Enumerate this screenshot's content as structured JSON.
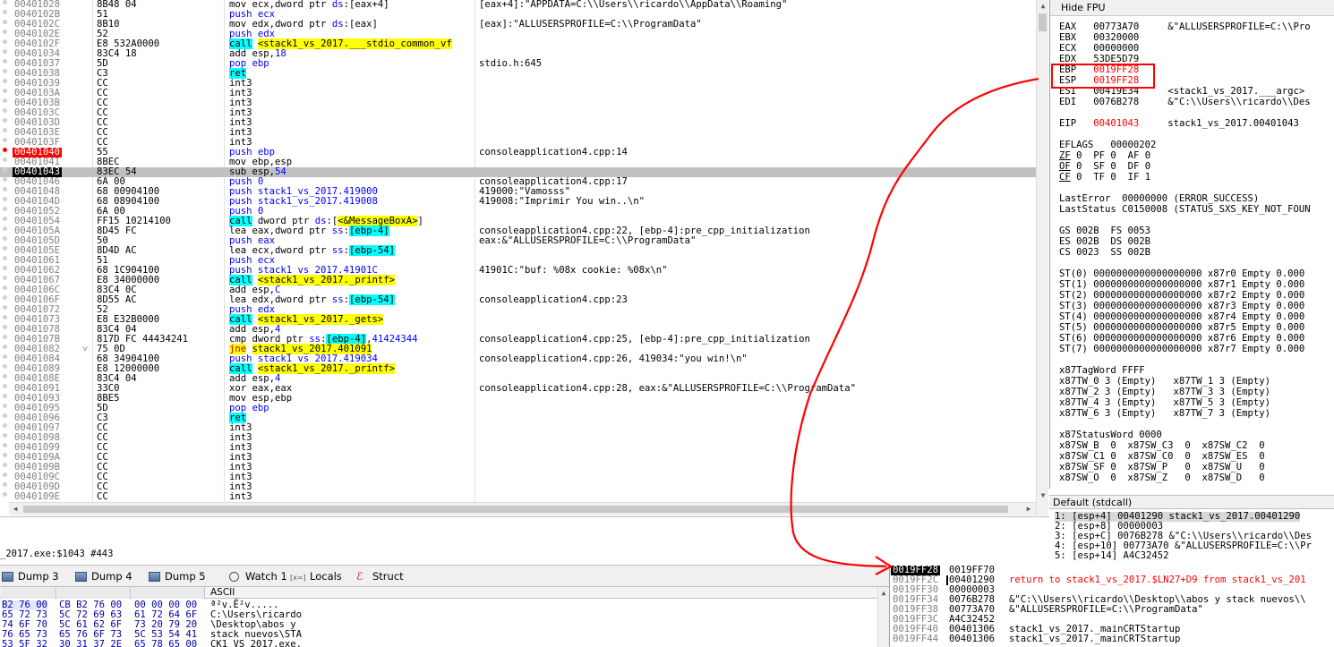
{
  "disassembly": [
    {
      "addr": "00401028",
      "bytes": "8B48 04",
      "instr": [
        [
          "",
          "mov ecx,dword ptr "
        ],
        [
          "mnem-push",
          "ds"
        ],
        [
          "",
          ":[eax+4]"
        ]
      ],
      "cmt": "[eax+4]:\"APPDATA=C:\\\\Users\\\\ricardo\\\\AppData\\\\Roaming\""
    },
    {
      "addr": "0040102B",
      "bytes": "51",
      "instr": [
        [
          "mnem-push",
          "push ecx"
        ]
      ],
      "cmt": ""
    },
    {
      "addr": "0040102C",
      "bytes": "8B10",
      "instr": [
        [
          "",
          "mov edx,dword ptr "
        ],
        [
          "mnem-push",
          "ds"
        ],
        [
          "",
          ":[eax]"
        ]
      ],
      "cmt": "[eax]:\"ALLUSERSPROFILE=C:\\\\ProgramData\""
    },
    {
      "addr": "0040102E",
      "bytes": "52",
      "instr": [
        [
          "mnem-push",
          "push edx"
        ]
      ],
      "cmt": ""
    },
    {
      "addr": "0040102F",
      "bytes": "E8 532A0000",
      "instr": [
        [
          "hl-call",
          "call"
        ],
        [
          "",
          " "
        ],
        [
          "hl-tgt",
          "<stack1_vs_2017.___stdio_common_vf"
        ]
      ],
      "cmt": ""
    },
    {
      "addr": "00401034",
      "bytes": "83C4 18",
      "instr": [
        [
          "",
          "add esp,"
        ],
        [
          "mnem-push",
          "18"
        ]
      ],
      "cmt": ""
    },
    {
      "addr": "00401037",
      "bytes": "5D",
      "instr": [
        [
          "mnem-push",
          "pop ebp"
        ]
      ],
      "cmt": "stdio.h:645"
    },
    {
      "addr": "00401038",
      "bytes": "C3",
      "instr": [
        [
          "hl-ret",
          "ret"
        ]
      ],
      "cmt": ""
    },
    {
      "addr": "00401039",
      "bytes": "CC",
      "instr": [
        [
          "",
          "int3"
        ]
      ],
      "cmt": ""
    },
    {
      "addr": "0040103A",
      "bytes": "CC",
      "instr": [
        [
          "",
          "int3"
        ]
      ],
      "cmt": ""
    },
    {
      "addr": "0040103B",
      "bytes": "CC",
      "instr": [
        [
          "",
          "int3"
        ]
      ],
      "cmt": ""
    },
    {
      "addr": "0040103C",
      "bytes": "CC",
      "instr": [
        [
          "",
          "int3"
        ]
      ],
      "cmt": ""
    },
    {
      "addr": "0040103D",
      "bytes": "CC",
      "instr": [
        [
          "",
          "int3"
        ]
      ],
      "cmt": ""
    },
    {
      "addr": "0040103E",
      "bytes": "CC",
      "instr": [
        [
          "",
          "int3"
        ]
      ],
      "cmt": ""
    },
    {
      "addr": "0040103F",
      "bytes": "CC",
      "instr": [
        [
          "",
          "int3"
        ]
      ],
      "cmt": ""
    },
    {
      "addr": "00401040",
      "bytes": "55",
      "instr": [
        [
          "mnem-push",
          "push ebp"
        ]
      ],
      "cmt": "consoleapplication4.cpp:14",
      "state": "bp"
    },
    {
      "addr": "00401041",
      "bytes": "8BEC",
      "instr": [
        [
          "",
          "mov ebp,esp"
        ]
      ],
      "cmt": ""
    },
    {
      "addr": "00401043",
      "bytes": "83EC 54",
      "instr": [
        [
          "",
          "sub esp,"
        ],
        [
          "mnem-push",
          "54"
        ]
      ],
      "cmt": "",
      "state": "cur"
    },
    {
      "addr": "00401046",
      "bytes": "6A 00",
      "instr": [
        [
          "mnem-push",
          "push 0"
        ]
      ],
      "cmt": "consoleapplication4.cpp:17"
    },
    {
      "addr": "00401048",
      "bytes": "68 00904100",
      "instr": [
        [
          "mnem-push",
          "push stack1_vs_2017.419000"
        ]
      ],
      "cmt": "419000:\"Vamosss\""
    },
    {
      "addr": "0040104D",
      "bytes": "68 08904100",
      "instr": [
        [
          "mnem-push",
          "push stack1_vs_2017.419008"
        ]
      ],
      "cmt": "419008:\"Imprimir You win..\\n\""
    },
    {
      "addr": "00401052",
      "bytes": "6A 00",
      "instr": [
        [
          "mnem-push",
          "push 0"
        ]
      ],
      "cmt": ""
    },
    {
      "addr": "00401054",
      "bytes": "FF15 10214100",
      "instr": [
        [
          "hl-call",
          "call"
        ],
        [
          "",
          " dword ptr "
        ],
        [
          "mnem-push",
          "ds"
        ],
        [
          "",
          ":["
        ],
        [
          "hl-tgt",
          "<&MessageBoxA>"
        ],
        [
          "",
          "]"
        ]
      ],
      "cmt": ""
    },
    {
      "addr": "0040105A",
      "bytes": "8D45 FC",
      "instr": [
        [
          "",
          "lea eax,dword ptr "
        ],
        [
          "mnem-push",
          "ss"
        ],
        [
          "",
          ":"
        ],
        [
          "hl-call",
          "[ebp-4]"
        ]
      ],
      "cmt": "consoleapplication4.cpp:22, [ebp-4]:pre_cpp_initialization"
    },
    {
      "addr": "0040105D",
      "bytes": "50",
      "instr": [
        [
          "mnem-push",
          "push eax"
        ]
      ],
      "cmt": "eax:&\"ALLUSERSPROFILE=C:\\\\ProgramData\""
    },
    {
      "addr": "0040105E",
      "bytes": "8D4D AC",
      "instr": [
        [
          "",
          "lea ecx,dword ptr "
        ],
        [
          "mnem-push",
          "ss"
        ],
        [
          "",
          ":"
        ],
        [
          "hl-call",
          "[ebp-54]"
        ]
      ],
      "cmt": ""
    },
    {
      "addr": "00401061",
      "bytes": "51",
      "instr": [
        [
          "mnem-push",
          "push ecx"
        ]
      ],
      "cmt": ""
    },
    {
      "addr": "00401062",
      "bytes": "68 1C904100",
      "instr": [
        [
          "mnem-push",
          "push stack1_vs_2017.41901C"
        ]
      ],
      "cmt": "41901C:\"buf: %08x cookie: %08x\\n\""
    },
    {
      "addr": "00401067",
      "bytes": "E8 34000000",
      "instr": [
        [
          "hl-call",
          "call"
        ],
        [
          "",
          " "
        ],
        [
          "hl-tgt",
          "<stack1_vs_2017._printf>"
        ]
      ],
      "cmt": ""
    },
    {
      "addr": "0040106C",
      "bytes": "83C4 0C",
      "instr": [
        [
          "",
          "add esp,"
        ],
        [
          "mnem-push",
          "C"
        ]
      ],
      "cmt": ""
    },
    {
      "addr": "0040106F",
      "bytes": "8D55 AC",
      "instr": [
        [
          "",
          "lea edx,dword ptr "
        ],
        [
          "mnem-push",
          "ss"
        ],
        [
          "",
          ":"
        ],
        [
          "hl-call",
          "[ebp-54]"
        ]
      ],
      "cmt": "consoleapplication4.cpp:23"
    },
    {
      "addr": "00401072",
      "bytes": "52",
      "instr": [
        [
          "mnem-push",
          "push edx"
        ]
      ],
      "cmt": ""
    },
    {
      "addr": "00401073",
      "bytes": "E8 E32B0000",
      "instr": [
        [
          "hl-call",
          "call"
        ],
        [
          "",
          " "
        ],
        [
          "hl-tgt",
          "<stack1_vs_2017._gets>"
        ]
      ],
      "cmt": ""
    },
    {
      "addr": "00401078",
      "bytes": "83C4 04",
      "instr": [
        [
          "",
          "add esp,"
        ],
        [
          "mnem-push",
          "4"
        ]
      ],
      "cmt": ""
    },
    {
      "addr": "0040107B",
      "bytes": "817D FC 44434241",
      "instr": [
        [
          "",
          "cmp dword ptr "
        ],
        [
          "mnem-push",
          "ss"
        ],
        [
          "",
          ":"
        ],
        [
          "hl-call",
          "[ebp-4]"
        ],
        [
          "",
          ","
        ],
        [
          "mnem-push",
          "41424344"
        ]
      ],
      "cmt": "consoleapplication4.cpp:25, [ebp-4]:pre_cpp_initialization"
    },
    {
      "addr": "00401082",
      "bytes": "75 0D",
      "instr": [
        [
          "hl-jne",
          "jne"
        ],
        [
          "",
          " "
        ],
        [
          "hl-tgt",
          "stack1_vs_2017.401091"
        ]
      ],
      "cmt": "",
      "jmp": "˅"
    },
    {
      "addr": "00401084",
      "bytes": "68 34904100",
      "instr": [
        [
          "mnem-push",
          "push stack1_vs_2017.419034"
        ]
      ],
      "cmt": "consoleapplication4.cpp:26, 419034:\"you win!\\n\""
    },
    {
      "addr": "00401089",
      "bytes": "E8 12000000",
      "instr": [
        [
          "hl-call",
          "call"
        ],
        [
          "",
          " "
        ],
        [
          "hl-tgt",
          "<stack1_vs_2017._printf>"
        ]
      ],
      "cmt": ""
    },
    {
      "addr": "0040108E",
      "bytes": "83C4 04",
      "instr": [
        [
          "",
          "add esp,"
        ],
        [
          "mnem-push",
          "4"
        ]
      ],
      "cmt": ""
    },
    {
      "addr": "00401091",
      "bytes": "33C0",
      "instr": [
        [
          "",
          "xor eax,eax"
        ]
      ],
      "cmt": "consoleapplication4.cpp:28, eax:&\"ALLUSERSPROFILE=C:\\\\ProgramData\""
    },
    {
      "addr": "00401093",
      "bytes": "8BE5",
      "instr": [
        [
          "",
          "mov esp,ebp"
        ]
      ],
      "cmt": ""
    },
    {
      "addr": "00401095",
      "bytes": "5D",
      "instr": [
        [
          "mnem-push",
          "pop ebp"
        ]
      ],
      "cmt": ""
    },
    {
      "addr": "00401096",
      "bytes": "C3",
      "instr": [
        [
          "hl-ret",
          "ret"
        ]
      ],
      "cmt": ""
    },
    {
      "addr": "00401097",
      "bytes": "CC",
      "instr": [
        [
          "",
          "int3"
        ]
      ],
      "cmt": ""
    },
    {
      "addr": "00401098",
      "bytes": "CC",
      "instr": [
        [
          "",
          "int3"
        ]
      ],
      "cmt": ""
    },
    {
      "addr": "00401099",
      "bytes": "CC",
      "instr": [
        [
          "",
          "int3"
        ]
      ],
      "cmt": ""
    },
    {
      "addr": "0040109A",
      "bytes": "CC",
      "instr": [
        [
          "",
          "int3"
        ]
      ],
      "cmt": ""
    },
    {
      "addr": "0040109B",
      "bytes": "CC",
      "instr": [
        [
          "",
          "int3"
        ]
      ],
      "cmt": ""
    },
    {
      "addr": "0040109C",
      "bytes": "CC",
      "instr": [
        [
          "",
          "int3"
        ]
      ],
      "cmt": ""
    },
    {
      "addr": "0040109D",
      "bytes": "CC",
      "instr": [
        [
          "",
          "int3"
        ]
      ],
      "cmt": ""
    },
    {
      "addr": "0040109E",
      "bytes": "CC",
      "instr": [
        [
          "",
          "int3"
        ]
      ],
      "cmt": ""
    }
  ],
  "info_text": "_2017.exe:$1043 #443",
  "registers": {
    "hide_fpu_label": "Hide FPU",
    "gp": [
      {
        "name": "EAX",
        "val": "00773A70",
        "cmt": "&\"ALLUSERSPROFILE=C:\\\\Pro"
      },
      {
        "name": "EBX",
        "val": "00320000",
        "cmt": ""
      },
      {
        "name": "ECX",
        "val": "00000000",
        "cmt": ""
      },
      {
        "name": "EDX",
        "val": "53DE5D79",
        "cmt": ""
      },
      {
        "name": "EBP",
        "val": "0019FF28",
        "cmt": "",
        "changed": true
      },
      {
        "name": "ESP",
        "val": "0019FF28",
        "cmt": "",
        "changed": true
      },
      {
        "name": "ESI",
        "val": "00419E34",
        "cmt": "<stack1_vs_2017.___argc>"
      },
      {
        "name": "EDI",
        "val": "0076B278",
        "cmt": "&\"C:\\\\Users\\\\ricardo\\\\Des"
      }
    ],
    "eip": {
      "name": "EIP",
      "val": "00401043",
      "cmt": "stack1_vs_2017.00401043"
    },
    "eflags": "EFLAGS   00000202",
    "flags": [
      [
        [
          "ZF",
          "0"
        ],
        [
          "PF",
          "0"
        ],
        [
          "AF",
          "0"
        ]
      ],
      [
        [
          "OF",
          "0"
        ],
        [
          "SF",
          "0"
        ],
        [
          "DF",
          "0"
        ]
      ],
      [
        [
          "CF",
          "0"
        ],
        [
          "TF",
          "0"
        ],
        [
          "IF",
          "1"
        ]
      ]
    ],
    "last_error": "LastError  00000000 (ERROR_SUCCESS)",
    "last_status": "LastStatus C0150008 (STATUS_SXS_KEY_NOT_FOUN",
    "segs": [
      "GS 002B  FS 0053",
      "ES 002B  DS 002B",
      "CS 0023  SS 002B"
    ],
    "st": [
      "ST(0) 0000000000000000000 x87r0 Empty 0.000",
      "ST(1) 0000000000000000000 x87r1 Empty 0.000",
      "ST(2) 0000000000000000000 x87r2 Empty 0.000",
      "ST(3) 0000000000000000000 x87r3 Empty 0.000",
      "ST(4) 0000000000000000000 x87r4 Empty 0.000",
      "ST(5) 0000000000000000000 x87r5 Empty 0.000",
      "ST(6) 0000000000000000000 x87r6 Empty 0.000",
      "ST(7) 0000000000000000000 x87r7 Empty 0.000"
    ],
    "tagword": "x87TagWord FFFF",
    "tw": [
      "x87TW_0 3 (Empty)   x87TW_1 3 (Empty)",
      "x87TW_2 3 (Empty)   x87TW_3 3 (Empty)",
      "x87TW_4 3 (Empty)   x87TW_5 3 (Empty)",
      "x87TW_6 3 (Empty)   x87TW_7 3 (Empty)"
    ],
    "statusword": "x87StatusWord 0000",
    "sw": [
      "x87SW_B  0  x87SW_C3  0  x87SW_C2  0",
      "x87SW_C1 0  x87SW_C0  0  x87SW_ES  0",
      "x87SW_SF 0  x87SW_P   0  x87SW_U   0",
      "x87SW_O  0  x87SW_Z   0  x87SW_D   0"
    ]
  },
  "callconv": {
    "header": "Default (stdcall)",
    "lines": [
      "1: [esp+4] 00401290 stack1_vs_2017.00401290",
      "2: [esp+8] 00000003",
      "3: [esp+C] 0076B278 &\"C:\\\\Users\\\\ricardo\\\\Des",
      "4: [esp+10] 00773A70 &\"ALLUSERSPROFILE=C:\\\\Pr",
      "5: [esp+14] A4C32452"
    ]
  },
  "tabs": [
    {
      "label": "Dump 3",
      "icon": "dump-icon"
    },
    {
      "label": "Dump 4",
      "icon": "dump-icon"
    },
    {
      "label": "Dump 5",
      "icon": "dump-icon"
    },
    {
      "label": "Watch 1",
      "icon": "watch-icon"
    },
    {
      "label": "Locals",
      "icon": "locals-icon"
    },
    {
      "label": "Struct",
      "icon": "struct-icon"
    }
  ],
  "dump": {
    "ascii_header": "ASCII",
    "hex1": [
      "B2 76 00",
      "65 72 73",
      "74 6F 70",
      "76 65 73",
      "53 5F 32"
    ],
    "hex2": [
      "CB B2 76 00",
      "5C 72 69 63",
      "5C 61 62 6F",
      "65 76 6F 73",
      "30 31 37 2E"
    ],
    "hex3": [
      "00 00 00 00",
      "61 72 64 6F",
      "73 20 79 20",
      "5C 53 54 41",
      "65 78 65 00"
    ],
    "ascii": [
      "ª²v.Ë²v.....",
      "C:\\Users\\ricardo",
      "\\Desktop\\abos y ",
      "stack nuevos\\STA",
      "CK1 VS 2017.exe."
    ]
  },
  "stack": [
    {
      "addr": "0019FF28",
      "val": "0019FF70",
      "cmt": "",
      "top": true
    },
    {
      "addr": "0019FF2C",
      "val": "00401290",
      "cmt": "return to stack1_vs_2017.$LN27+D9 from stack1_vs_201",
      "ret": true
    },
    {
      "addr": "0019FF30",
      "val": "00000003",
      "cmt": ""
    },
    {
      "addr": "0019FF34",
      "val": "0076B278",
      "cmt": "&\"C:\\\\Users\\\\ricardo\\\\Desktop\\\\abos y stack nuevos\\\\"
    },
    {
      "addr": "0019FF38",
      "val": "00773A70",
      "cmt": "&\"ALLUSERSPROFILE=C:\\\\ProgramData\""
    },
    {
      "addr": "0019FF3C",
      "val": "A4C32452",
      "cmt": ""
    },
    {
      "addr": "0019FF40",
      "val": "00401306",
      "cmt": "stack1_vs_2017._mainCRTStartup"
    },
    {
      "addr": "0019FF44",
      "val": "00401306",
      "cmt": "stack1_vs_2017._mainCRTStartup"
    }
  ],
  "colors": {
    "annotation": "#ff0000",
    "breakpoint": "#ff0000",
    "call_highlight": "#00ffff",
    "target_highlight": "#ffff00",
    "push_blue": "#0000ff"
  }
}
